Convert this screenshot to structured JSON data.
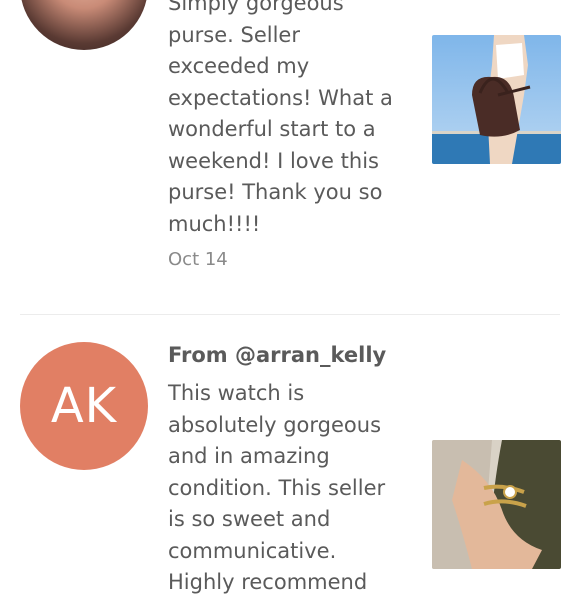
{
  "reviews": [
    {
      "avatar_kind": "photo",
      "text": "Simply gorgeous purse. Seller exceeded my expectations! What a wonderful start to a weekend! I love this purse! Thank you so much!!!!",
      "date": "Oct 14",
      "image_icon": "purse-photo"
    },
    {
      "avatar_kind": "initials",
      "initials": "AK",
      "avatar_color": "#e17f64",
      "from": "From @arran_kelly",
      "text": "This watch is absolutely gorgeous and in amazing condition. This seller is so sweet and communicative. Highly recommend",
      "image_icon": "watch-photo"
    }
  ]
}
